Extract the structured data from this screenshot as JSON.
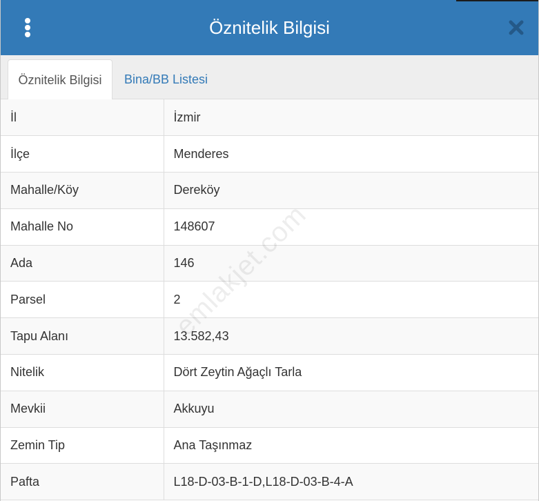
{
  "dialog": {
    "title": "Öznitelik Bilgisi"
  },
  "tabs": [
    {
      "label": "Öznitelik Bilgisi",
      "active": true
    },
    {
      "label": "Bina/BB Listesi",
      "active": false
    }
  ],
  "attributes": [
    {
      "key": "İl",
      "value": "İzmir"
    },
    {
      "key": "İlçe",
      "value": "Menderes"
    },
    {
      "key": "Mahalle/Köy",
      "value": "Dereköy"
    },
    {
      "key": "Mahalle No",
      "value": "148607"
    },
    {
      "key": "Ada",
      "value": "146"
    },
    {
      "key": "Parsel",
      "value": "2"
    },
    {
      "key": "Tapu Alanı",
      "value": "13.582,43"
    },
    {
      "key": "Nitelik",
      "value": "Dört Zeytin Ağaçlı Tarla"
    },
    {
      "key": "Mevkii",
      "value": "Akkuyu"
    },
    {
      "key": "Zemin Tip",
      "value": "Ana Taşınmaz"
    },
    {
      "key": "Pafta",
      "value": "L18-D-03-B-1-D,L18-D-03-B-4-A"
    }
  ],
  "watermark": "emlakjet.com",
  "icons": {
    "menu": "vertical-dots-icon",
    "close": "close-icon"
  },
  "colors": {
    "header": "#337ab7",
    "tab_link": "#337ab7"
  }
}
